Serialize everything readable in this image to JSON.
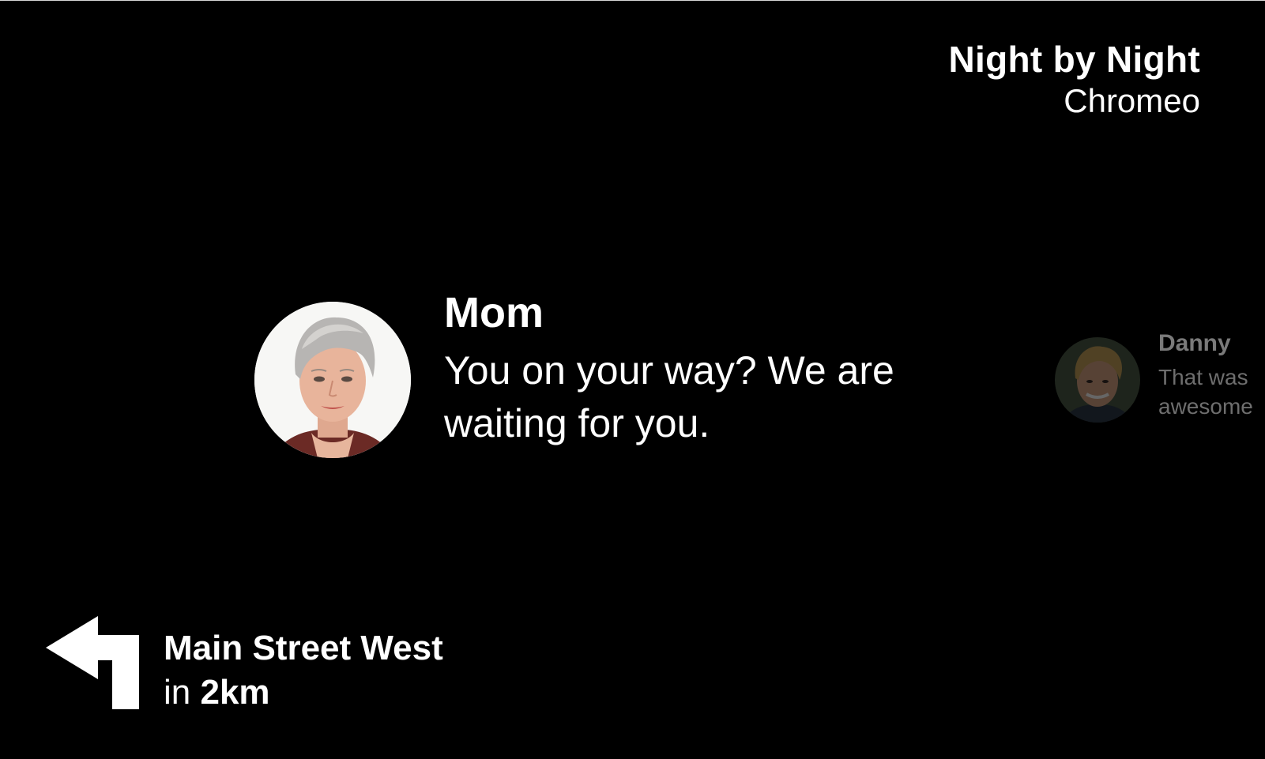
{
  "now_playing": {
    "title": "Night by Night",
    "artist": "Chromeo"
  },
  "message": {
    "sender": "Mom",
    "text": "You on your way? We are waiting for you.",
    "avatar_icon": "avatar-photo-mom"
  },
  "secondary_message": {
    "sender": "Danny",
    "text_line1": "That was",
    "text_line2": "awesome",
    "avatar_icon": "avatar-photo-danny"
  },
  "navigation": {
    "street": "Main Street West",
    "prefix": "in",
    "distance": "2km",
    "icon": "turn-left-arrow-icon"
  },
  "colors": {
    "background": "#000000",
    "primary_text": "#ffffff",
    "dimmed_text": "#6e6e6e"
  }
}
